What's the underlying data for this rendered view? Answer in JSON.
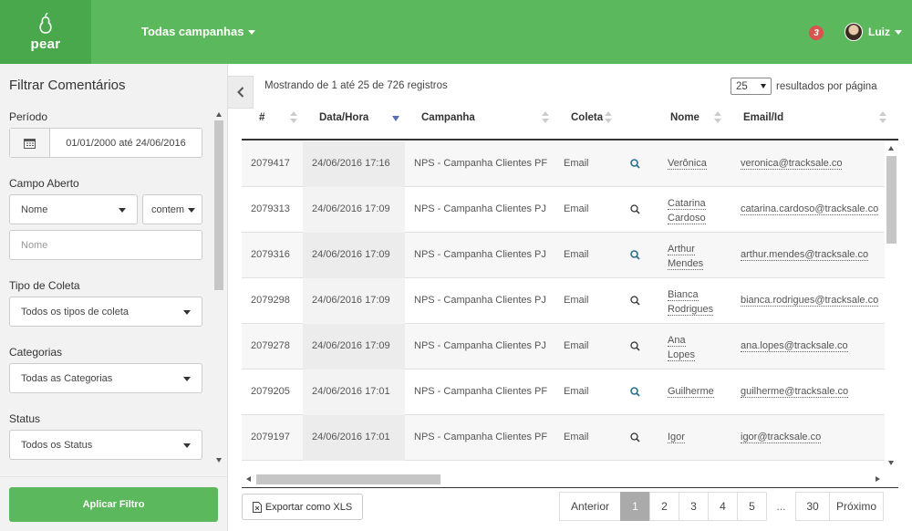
{
  "app": {
    "logo_text": "pear",
    "campaign_selector": "Todas campanhas",
    "notifications": "3",
    "user_name": "Luiz"
  },
  "sidebar": {
    "title": "Filtrar Comentários",
    "period": {
      "label": "Período",
      "value": "01/01/2000 até 24/06/2016"
    },
    "open_field": {
      "label": "Campo Aberto",
      "field_select": "Nome",
      "operator_select": "contem",
      "text_placeholder": "Nome"
    },
    "collection_type": {
      "label": "Tipo de Coleta",
      "value": "Todos os tipos de coleta"
    },
    "categories": {
      "label": "Categorias",
      "value": "Todas as Categorias"
    },
    "status": {
      "label": "Status",
      "value": "Todos os Status"
    },
    "apply_button": "Aplicar Filtro"
  },
  "table": {
    "showing_text": "Mostrando de 1 até 25 de 726 registros",
    "per_page_value": "25",
    "per_page_label": "resultados por página",
    "columns": {
      "id": "#",
      "date": "Data/Hora",
      "campaign": "Campanha",
      "type": "Coleta",
      "name": "Nome",
      "email": "Email/Id"
    },
    "rows": [
      {
        "id": "2079417",
        "date": "24/06/2016 17:16",
        "campaign": "NPS - Campanha Clientes PF",
        "type": "Email",
        "name1": "Verônica",
        "name2": "",
        "email": "veronica@tracksale.co",
        "icon_color": "#2a6f8e"
      },
      {
        "id": "2079313",
        "date": "24/06/2016 17:09",
        "campaign": "NPS - Campanha Clientes PJ",
        "type": "Email",
        "name1": "Catarina",
        "name2": "Cardoso",
        "email": "catarina.cardoso@tracksale.co",
        "icon_color": "#333333"
      },
      {
        "id": "2079316",
        "date": "24/06/2016 17:09",
        "campaign": "NPS - Campanha Clientes PJ",
        "type": "Email",
        "name1": "Arthur",
        "name2": "Mendes",
        "email": "arthur.mendes@tracksale.co",
        "icon_color": "#2a6f8e"
      },
      {
        "id": "2079298",
        "date": "24/06/2016 17:09",
        "campaign": "NPS - Campanha Clientes PJ",
        "type": "Email",
        "name1": "Bianca",
        "name2": "Rodrigues",
        "email": "bianca.rodrigues@tracksale.co",
        "icon_color": "#333333"
      },
      {
        "id": "2079278",
        "date": "24/06/2016 17:09",
        "campaign": "NPS - Campanha Clientes PJ",
        "type": "Email",
        "name1": "Ana",
        "name2": "Lopes",
        "email": "ana.lopes@tracksale.co",
        "icon_color": "#333333"
      },
      {
        "id": "2079205",
        "date": "24/06/2016 17:01",
        "campaign": "NPS - Campanha Clientes PF",
        "type": "Email",
        "name1": "Guilherme",
        "name2": "",
        "email": "guilherme@tracksale.co",
        "icon_color": "#2a6f8e"
      },
      {
        "id": "2079197",
        "date": "24/06/2016 17:01",
        "campaign": "NPS - Campanha Clientes PF",
        "type": "Email",
        "name1": "Igor",
        "name2": "",
        "email": "igor@tracksale.co",
        "icon_color": "#333333"
      }
    ]
  },
  "footer": {
    "export_label": "Exportar como XLS",
    "pagination": {
      "previous": "Anterior",
      "pages": [
        "1",
        "2",
        "3",
        "4",
        "5"
      ],
      "current": "1",
      "ellipsis": "...",
      "last": "30",
      "next": "Próximo"
    }
  },
  "colors": {
    "brand_green": "#5cb85c",
    "brand_green_dark": "#4aa84c",
    "badge_red": "#d9534f",
    "sort_active": "#5570b5"
  }
}
